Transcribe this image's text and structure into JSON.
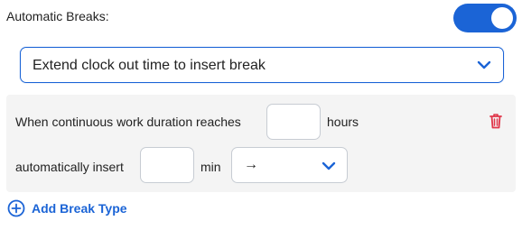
{
  "automatic_breaks": {
    "label": "Automatic Breaks:",
    "enabled": true
  },
  "mode_select": {
    "value": "Extend clock out time to insert break"
  },
  "rule": {
    "duration_label": "When continuous work duration reaches",
    "duration_value": "",
    "duration_unit": "hours",
    "insert_label": "automatically insert",
    "insert_value": "",
    "insert_unit": "min",
    "break_type_value": "→"
  },
  "add_break_type": {
    "label": "Add Break Type"
  },
  "colors": {
    "accent": "#1b64d6",
    "danger": "#e0364a",
    "panel_bg": "#f4f4f4"
  },
  "icons": {
    "toggle": "toggle-switch-on",
    "dropdown": "chevron-down-icon",
    "delete": "trash-icon",
    "add": "plus-circle-icon"
  }
}
